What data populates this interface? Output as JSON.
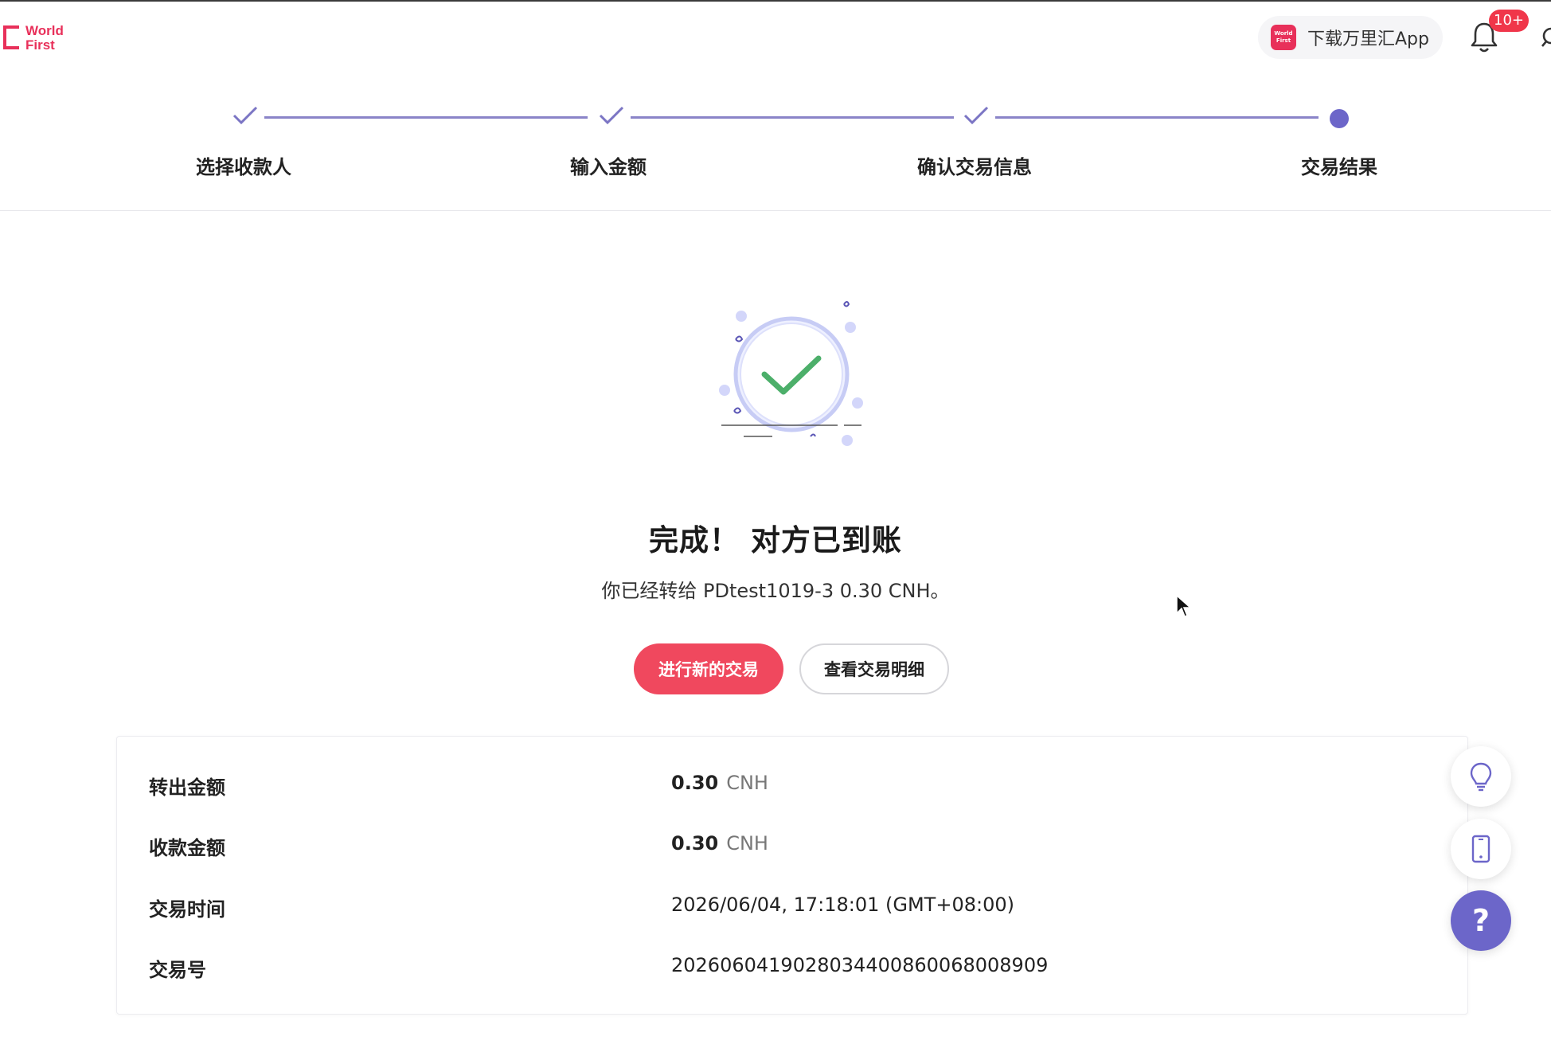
{
  "header": {
    "logo_line1": "World",
    "logo_line2": "First",
    "app_icon_text": "World First",
    "download_app_label": "下载万里汇App",
    "notification_badge": "10+"
  },
  "stepper": {
    "steps": [
      {
        "label": "选择收款人",
        "status": "done"
      },
      {
        "label": "输入金额",
        "status": "done"
      },
      {
        "label": "确认交易信息",
        "status": "done"
      },
      {
        "label": "交易结果",
        "status": "current"
      }
    ]
  },
  "result": {
    "title": "完成！ 对方已到账",
    "subtitle": "你已经转给 PDtest1019-3 0.30 CNH。",
    "new_transaction_label": "进行新的交易",
    "view_details_label": "查看交易明细"
  },
  "details": {
    "rows": [
      {
        "label": "转出金额",
        "amount": "0.30",
        "currency": "CNH"
      },
      {
        "label": "收款金额",
        "amount": "0.30",
        "currency": "CNH"
      },
      {
        "label": "交易时间",
        "value": "2026/06/04, 17:18:01 (GMT+08:00)"
      },
      {
        "label": "交易号",
        "value": "20260604190280344008600680​08909"
      }
    ]
  },
  "floating": {
    "help_label": "?"
  },
  "colors": {
    "brand": "#e8305a",
    "primary_button": "#f0485e",
    "accent_purple": "#6c66c9",
    "success_green": "#4caf6a"
  }
}
